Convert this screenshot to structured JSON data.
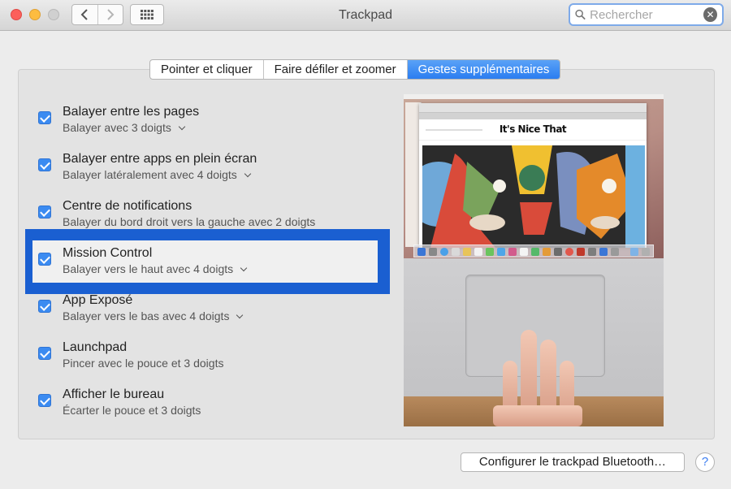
{
  "window": {
    "title": "Trackpad"
  },
  "search": {
    "placeholder": "Rechercher",
    "value": ""
  },
  "tabs": [
    {
      "label": "Pointer et cliquer",
      "active": false
    },
    {
      "label": "Faire défiler et zoomer",
      "active": false
    },
    {
      "label": "Gestes supplémentaires",
      "active": true
    }
  ],
  "gestures": [
    {
      "title": "Balayer entre les pages",
      "subtitle": "Balayer avec 3 doigts",
      "checked": true,
      "has_menu": true
    },
    {
      "title": "Balayer entre apps en plein écran",
      "subtitle": "Balayer latéralement avec 4 doigts",
      "checked": true,
      "has_menu": true
    },
    {
      "title": "Centre de notifications",
      "subtitle": "Balayer du bord droit vers la gauche avec 2 doigts",
      "checked": true,
      "has_menu": false
    },
    {
      "title": "Mission Control",
      "subtitle": "Balayer vers le haut avec 4 doigts",
      "checked": true,
      "has_menu": true,
      "highlighted": true
    },
    {
      "title": "App Exposé",
      "subtitle": "Balayer vers le bas avec 4 doigts",
      "checked": true,
      "has_menu": true
    },
    {
      "title": "Launchpad",
      "subtitle": "Pincer avec le pouce et 3 doigts",
      "checked": true,
      "has_menu": false
    },
    {
      "title": "Afficher le bureau",
      "subtitle": "Écarter le pouce et 3 doigts",
      "checked": true,
      "has_menu": false
    }
  ],
  "preview": {
    "site_logo": "It's Nice That"
  },
  "footer": {
    "bluetooth_button": "Configurer le trackpad Bluetooth…",
    "help_label": "?"
  },
  "colors": {
    "accent": "#3b8bf1",
    "highlight": "#1a5fd1"
  }
}
